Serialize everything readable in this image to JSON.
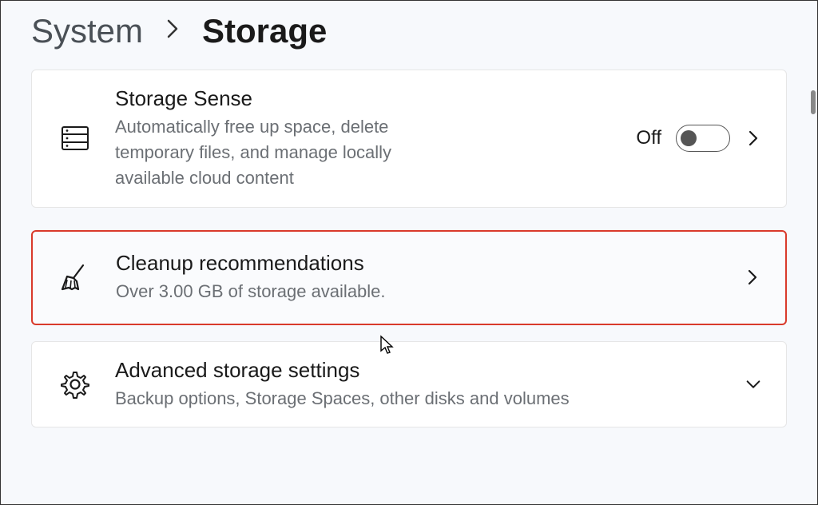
{
  "breadcrumb": {
    "parent": "System",
    "current": "Storage"
  },
  "cards": {
    "storageSense": {
      "title": "Storage Sense",
      "desc": "Automatically free up space, delete temporary files, and manage locally available cloud content",
      "toggleState": "Off"
    },
    "cleanup": {
      "title": "Cleanup recommendations",
      "desc": "Over 3.00 GB of storage available."
    },
    "advanced": {
      "title": "Advanced storage settings",
      "desc": "Backup options, Storage Spaces, other disks and volumes"
    }
  }
}
